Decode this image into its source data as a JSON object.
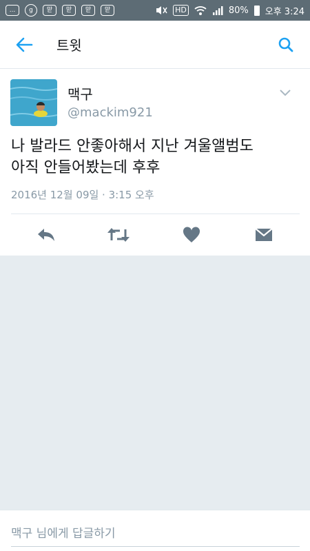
{
  "statusbar": {
    "icon_chat": "...",
    "icon_g": "g",
    "icon_app1": "맏",
    "icon_app2": "맏",
    "icon_app3": "맏",
    "icon_app4": "맏",
    "hd": "HD",
    "battery": "80%",
    "time": "오후 3:24"
  },
  "toolbar": {
    "title": "트윗"
  },
  "tweet": {
    "name": "맥구",
    "handle": "@mackim921",
    "text_line1": "나 발라드 안좋아해서 지난 겨울앨범도",
    "text_line2": "아직 안들어봤는데 후후",
    "timestamp": "2016년 12월 09일 · 3:15 오후"
  },
  "reply": {
    "placeholder": "맥구 님에게 답글하기"
  },
  "colors": {
    "accent": "#1da1f2",
    "statusbar": "#5d6c75",
    "secondary_text": "#8899a6",
    "icon_gray": "#657786",
    "background_gray": "#e6ecf0"
  }
}
